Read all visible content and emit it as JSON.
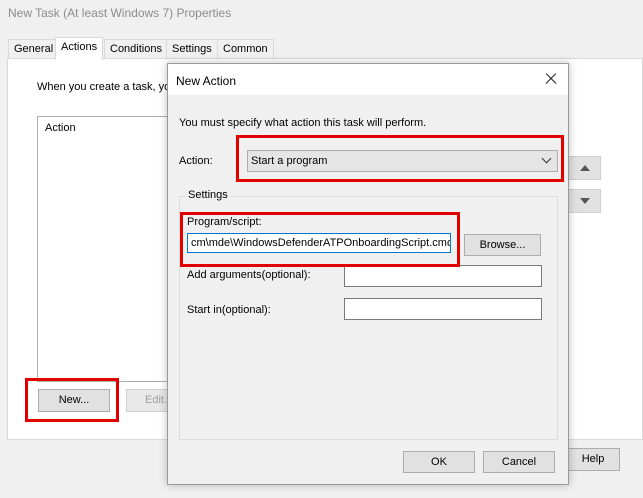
{
  "window": {
    "title": "New Task (At least Windows 7) Properties"
  },
  "tabs": [
    {
      "label": "General"
    },
    {
      "label": "Actions"
    },
    {
      "label": "Conditions"
    },
    {
      "label": "Settings"
    },
    {
      "label": "Common"
    }
  ],
  "actions_tab": {
    "intro_text": "When you create a task, yo",
    "list_header": "Action",
    "new_button": "New...",
    "edit_button": "Edit..."
  },
  "footer": {
    "help_button": "Help"
  },
  "dialog": {
    "title": "New Action",
    "instruction": "You must specify what action this task will perform.",
    "action_label": "Action:",
    "action_value": "Start a program",
    "settings_legend": "Settings",
    "program_label": "Program/script:",
    "program_value": "cm\\mde\\WindowsDefenderATPOnboardingScript.cmd",
    "browse_button": "Browse...",
    "arguments_label": "Add arguments(optional):",
    "arguments_value": "",
    "start_in_label": "Start in(optional):",
    "start_in_value": "",
    "ok_button": "OK",
    "cancel_button": "Cancel"
  },
  "colors": {
    "highlight": "#e00000",
    "focus_border": "#0078d7"
  }
}
